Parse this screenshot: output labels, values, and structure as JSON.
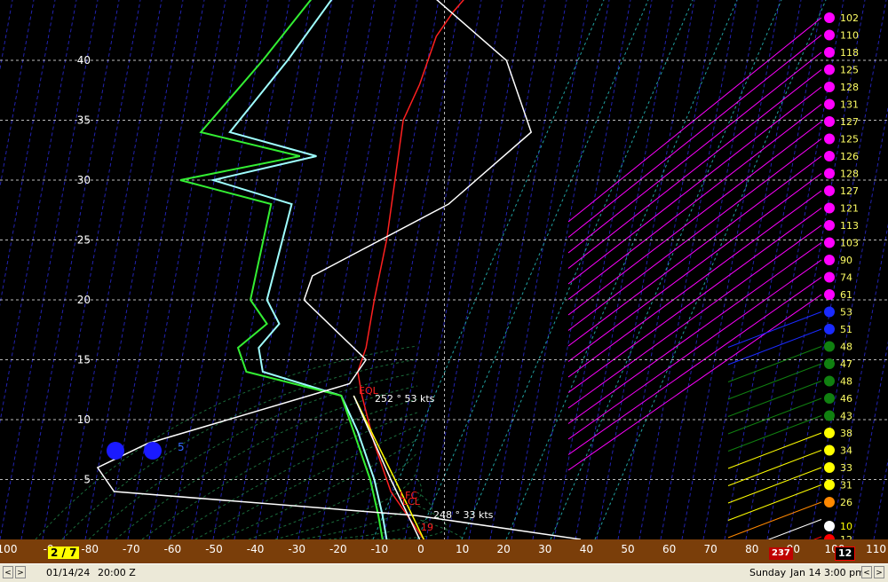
{
  "chart_data": {
    "type": "line",
    "ylabel_ticks": [
      "5",
      "10",
      "15",
      "20",
      "25",
      "30",
      "35",
      "40"
    ],
    "xlabel_ticks": [
      "100",
      "-9",
      "-80",
      "-70",
      "-60",
      "-50",
      "-40",
      "-30",
      "-20",
      "-10",
      "0",
      "10",
      "20",
      "30",
      "40",
      "50",
      "60",
      "70",
      "80",
      "90",
      "100",
      "110"
    ],
    "xlim": [
      -100,
      110
    ],
    "ylim": [
      0,
      44
    ],
    "series": [
      {
        "color": "#ff2020",
        "x": [
          2,
          -2,
          -6,
          -10,
          -13,
          -14,
          -12,
          -10,
          -7,
          -5,
          -3,
          1,
          5,
          9,
          14
        ],
        "y": [
          0,
          2,
          4,
          8,
          12,
          14,
          16,
          20,
          25,
          30,
          35,
          38,
          42,
          44,
          46
        ]
      },
      {
        "color": "#9fffff",
        "x": [
          -7,
          -8,
          -10,
          -14,
          -18,
          -37,
          -38,
          -33,
          -36,
          -30,
          -49,
          -24,
          -45,
          -31,
          -10
        ],
        "y": [
          0,
          2,
          5,
          9,
          12,
          14,
          16,
          18,
          20,
          28,
          30,
          32,
          34,
          40,
          50
        ]
      },
      {
        "color": "#33ee33",
        "x": [
          -8,
          -9,
          -11,
          -15,
          -18,
          -41,
          -43,
          -36,
          -40,
          -35,
          -57,
          -28,
          -52,
          -37,
          -14
        ],
        "y": [
          0,
          2,
          5,
          9,
          12,
          14,
          16,
          18,
          20,
          28,
          30,
          32,
          34,
          40,
          50
        ]
      },
      {
        "color": "#ffffff",
        "x": [
          40,
          0,
          -73,
          -77,
          -65,
          -16,
          -12,
          -27,
          -25,
          8,
          28,
          22,
          2
        ],
        "y": [
          0,
          2,
          4,
          6,
          8,
          13,
          15,
          20,
          22,
          28,
          34,
          40,
          46
        ]
      },
      {
        "color": "#ffff00",
        "x": [
          2,
          -5,
          -15
        ],
        "y": [
          0,
          5,
          12
        ]
      },
      {
        "color": "#ffffff",
        "x": [
          1,
          -6,
          -15
        ],
        "y": [
          0,
          5,
          12
        ]
      }
    ],
    "annotations": {
      "wind_upper": "252 ° 53 kts",
      "wind_lower": "248 ° 33 kts",
      "el_label": "EQL",
      "lfc_label": "LFC",
      "lcl_label": "LCL",
      "surface_label": "19",
      "blue_label": "5"
    },
    "right_column": [
      {
        "value": "102",
        "color": "#ff00ff"
      },
      {
        "value": "110",
        "color": "#ff00ff"
      },
      {
        "value": "118",
        "color": "#ff00ff"
      },
      {
        "value": "125",
        "color": "#ff00ff"
      },
      {
        "value": "128",
        "color": "#ff00ff"
      },
      {
        "value": "131",
        "color": "#ff00ff"
      },
      {
        "value": "127",
        "color": "#ff00ff"
      },
      {
        "value": "125",
        "color": "#ff00ff"
      },
      {
        "value": "126",
        "color": "#ff00ff"
      },
      {
        "value": "128",
        "color": "#ff00ff"
      },
      {
        "value": "127",
        "color": "#ff00ff"
      },
      {
        "value": "121",
        "color": "#ff00ff"
      },
      {
        "value": "113",
        "color": "#ff00ff"
      },
      {
        "value": "103",
        "color": "#ff00ff"
      },
      {
        "value": "90",
        "color": "#ff00ff"
      },
      {
        "value": "74",
        "color": "#ff00ff"
      },
      {
        "value": "61",
        "color": "#ff00ff"
      },
      {
        "value": "53",
        "color": "#1a2aff"
      },
      {
        "value": "51",
        "color": "#1a2aff"
      },
      {
        "value": "48",
        "color": "#108010"
      },
      {
        "value": "47",
        "color": "#108010"
      },
      {
        "value": "48",
        "color": "#108010"
      },
      {
        "value": "46",
        "color": "#108010"
      },
      {
        "value": "43",
        "color": "#108010"
      },
      {
        "value": "38",
        "color": "#ffff00"
      },
      {
        "value": "34",
        "color": "#ffff00"
      },
      {
        "value": "33",
        "color": "#ffff00"
      },
      {
        "value": "31",
        "color": "#ffff00"
      },
      {
        "value": "26",
        "color": "#ff8800"
      },
      {
        "value": "10",
        "color": "#ffffff"
      },
      {
        "value": "12",
        "color": "#ff0000"
      }
    ]
  },
  "axisbar": {
    "yellow_box": "2 / 7",
    "red_box_left": "237",
    "red_box_right": "12"
  },
  "statusbar": {
    "prev_btn": "<",
    "next_btn": ">",
    "date": "01/14/24",
    "time": "20:00 Z",
    "day": "Sunday",
    "datetime": "Jan 14  3:00 pm",
    "nav_prev2": "<",
    "nav_next2": ">"
  }
}
